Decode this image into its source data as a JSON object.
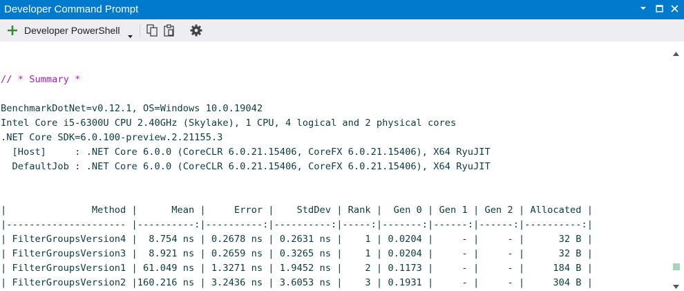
{
  "window": {
    "title": "Developer Command Prompt",
    "controls": {
      "minimize_icon": "chevron-down-icon",
      "maximize_icon": "maximize-icon",
      "close_icon": "close-icon"
    }
  },
  "toolbar": {
    "new_tab_icon": "plus-icon",
    "profile_label": "Developer PowerShell",
    "dropdown_icon": "caret-down-icon",
    "copy_icon": "copy-icon",
    "paste_icon": "paste-icon",
    "settings_icon": "gear-icon"
  },
  "terminal": {
    "lines": [
      "",
      "// * Summary *",
      "",
      "BenchmarkDotNet=v0.12.1, OS=Windows 10.0.19042",
      "Intel Core i5-6300U CPU 2.40GHz (Skylake), 1 CPU, 4 logical and 2 physical cores",
      ".NET Core SDK=6.0.100-preview.2.21155.3",
      "  [Host]     : .NET Core 6.0.0 (CoreCLR 6.0.21.15406, CoreFX 6.0.21.15406), X64 RyuJIT",
      "  DefaultJob : .NET Core 6.0.0 (CoreCLR 6.0.21.15406, CoreFX 6.0.21.15406), X64 RyuJIT",
      "",
      "",
      "|               Method |      Mean |     Error |    StdDev | Rank |  Gen 0 | Gen 1 | Gen 2 | Allocated |",
      "|--------------------- |----------:|----------:|----------:|-----:|-------:|------:|------:|----------:|",
      "| FilterGroupsVersion4 |  8.754 ns | 0.2678 ns | 0.2631 ns |    1 | 0.0204 |     - |     - |      32 B |",
      "| FilterGroupsVersion3 |  8.921 ns | 0.2659 ns | 0.3265 ns |    1 | 0.0204 |     - |     - |      32 B |",
      "| FilterGroupsVersion1 | 61.049 ns | 1.3271 ns | 1.9452 ns |    2 | 0.1173 |     - |     - |     184 B |",
      "| FilterGroupsVersion2 |160.216 ns | 3.2436 ns | 3.6053 ns |    3 | 0.1931 |     - |     - |     304 B |"
    ]
  },
  "colors": {
    "titlebar": "#007acc",
    "toolbar": "#eeeef2",
    "terminal_text": "#0c3b3b",
    "comment_text": "#9b25a8",
    "plus_icon": "#388a34",
    "scroll_thumb": "#a9d3b6"
  }
}
